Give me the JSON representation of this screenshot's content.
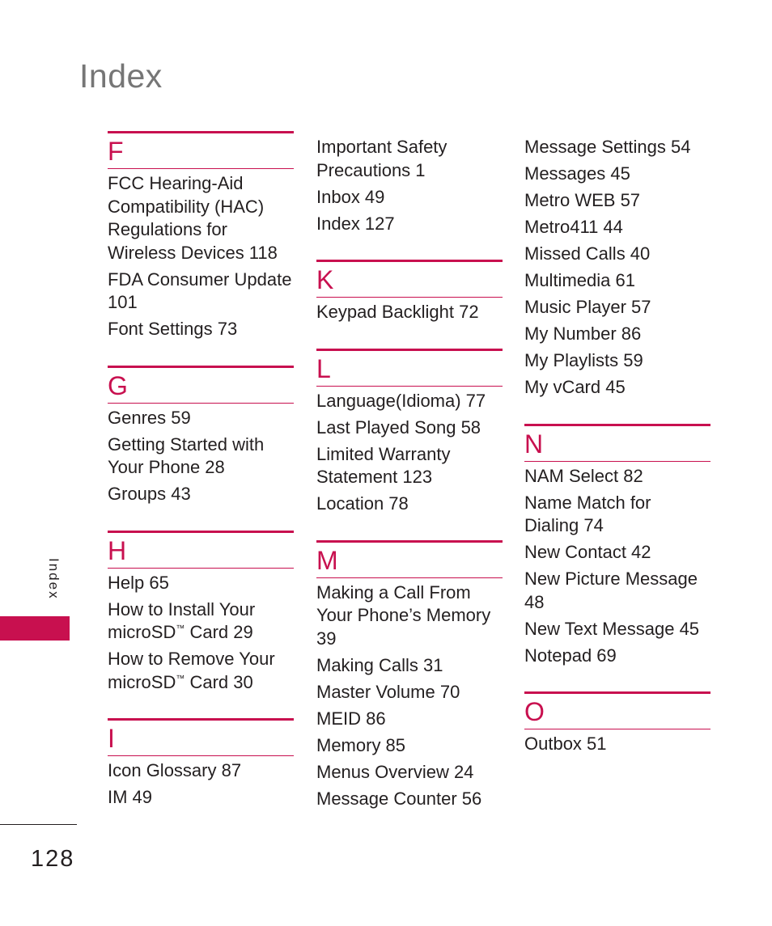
{
  "page": {
    "title": "Index",
    "side_label": "Index",
    "page_number": "128",
    "accent_color": "#c8104f"
  },
  "columns": [
    {
      "sections": [
        {
          "letter": "F",
          "entries": [
            "FCC Hearing-Aid\nCompatibility (HAC)\nRegulations for\nWireless Devices 118",
            "FDA Consumer Update\n101",
            "Font Settings 73"
          ]
        },
        {
          "letter": "G",
          "entries": [
            "Genres 59",
            "Getting Started with\nYour Phone 28",
            "Groups 43"
          ]
        },
        {
          "letter": "H",
          "entries": [
            "Help 65",
            "How to Install Your\nmicroSD™ Card 29",
            "How to Remove Your\nmicroSD™ Card 30"
          ]
        },
        {
          "letter": "I",
          "entries": [
            "Icon Glossary 87",
            "IM 49"
          ]
        }
      ]
    },
    {
      "continued_entries": [
        "Important Safety\nPrecautions 1",
        "Inbox 49",
        "Index 127"
      ],
      "sections": [
        {
          "letter": "K",
          "entries": [
            "Keypad Backlight 72"
          ]
        },
        {
          "letter": "L",
          "entries": [
            "Language(Idioma) 77",
            "Last Played Song 58",
            "Limited Warranty\nStatement 123",
            "Location 78"
          ]
        },
        {
          "letter": "M",
          "entries": [
            "Making a Call From\nYour Phone’s Memory\n39",
            "Making Calls 31",
            "Master Volume 70",
            "MEID 86",
            "Memory 85",
            "Menus Overview 24",
            "Message Counter 56"
          ]
        }
      ]
    },
    {
      "continued_entries": [
        "Message Settings 54",
        "Messages 45",
        "Metro WEB 57",
        "Metro411  44",
        "Missed Calls 40",
        "Multimedia 61",
        "Music Player 57",
        "My Number 86",
        "My Playlists 59",
        "My vCard 45"
      ],
      "sections": [
        {
          "letter": "N",
          "entries": [
            "NAM Select 82",
            "Name Match for\nDialing 74",
            "New Contact 42",
            "New Picture Message\n48",
            "New Text Message 45",
            "Notepad 69"
          ]
        },
        {
          "letter": "O",
          "entries": [
            "Outbox 51"
          ]
        }
      ]
    }
  ]
}
